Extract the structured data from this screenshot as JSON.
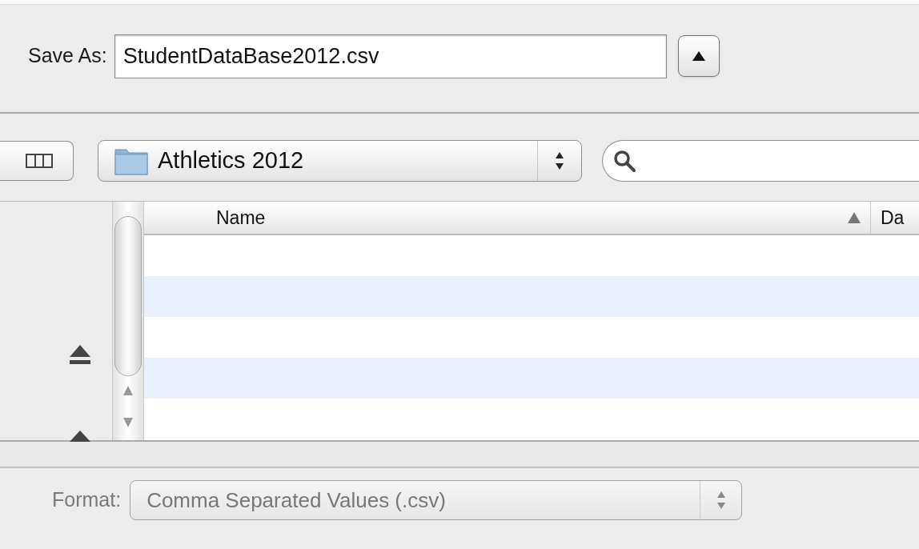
{
  "save_as": {
    "label": "Save As:",
    "value": "StudentDataBase2012.csv"
  },
  "location": {
    "folder": "Athletics 2012"
  },
  "file_list": {
    "columns": [
      {
        "label": "Name",
        "sorted": true
      },
      {
        "label": "Da",
        "sorted": false
      }
    ]
  },
  "format": {
    "label": "Format:",
    "value": "Comma Separated Values (.csv)",
    "disabled": true
  }
}
